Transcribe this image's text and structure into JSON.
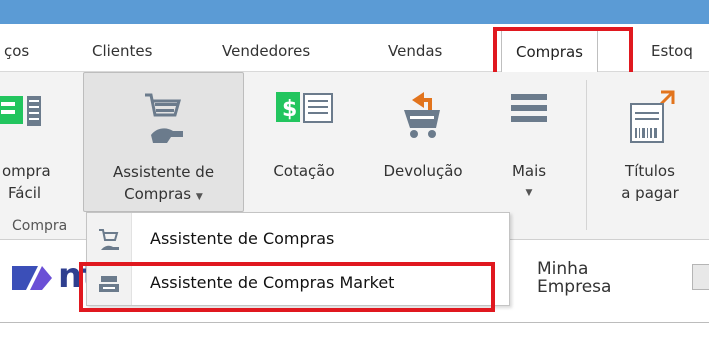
{
  "tabs": [
    {
      "label": "ços"
    },
    {
      "label": "Clientes"
    },
    {
      "label": "Vendedores"
    },
    {
      "label": "Vendas"
    },
    {
      "label": "Compras"
    },
    {
      "label": "Estoq"
    }
  ],
  "ribbon": {
    "buttons": [
      {
        "line1": "ompra",
        "line2": "Fácil",
        "icon": "easy-purchase-icon"
      },
      {
        "line1": "Assistente de",
        "line2": "Compras",
        "icon": "cart-hand-icon"
      },
      {
        "line1": "Cotação",
        "icon": "quotation-icon"
      },
      {
        "line1": "Devolução",
        "icon": "cart-return-icon"
      },
      {
        "line1": "Mais",
        "icon": "hamburger-icon"
      },
      {
        "line1": "Títulos",
        "line2": "a pagar",
        "icon": "bills-to-pay-icon"
      }
    ],
    "group_label": "Compra"
  },
  "dropdown": {
    "items": [
      {
        "label": "Assistente de Compras",
        "icon": "cart-hand-icon"
      },
      {
        "label": "Assistente de Compras Market",
        "icon": "cash-register-icon"
      }
    ]
  },
  "brand": {
    "text": "nt"
  },
  "company": {
    "line1": "Minha",
    "line2": "Empresa"
  },
  "colors": {
    "top_bar": "#5b9bd5",
    "highlight": "#e0181f",
    "ribbon_bg": "#f3f3f3",
    "icon_green": "#22c55e",
    "icon_gray": "#6b7b8c",
    "return_arrow": "#e2741d"
  }
}
